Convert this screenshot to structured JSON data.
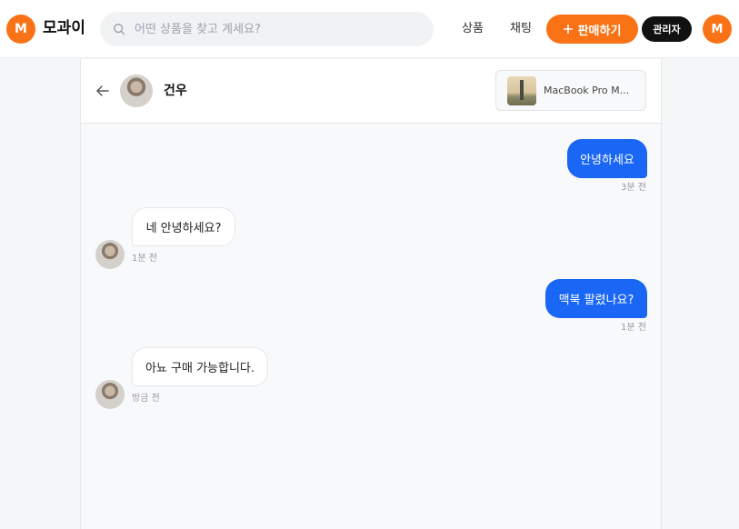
{
  "header": {
    "logo_letter": "M",
    "brand": "모과이",
    "search_placeholder": "어떤 상품을 찾고 계세요?",
    "nav": {
      "products": "상품",
      "chat": "채팅"
    },
    "sell_label": "판매하기",
    "admin_label": "관리자",
    "user_initial": "M",
    "accent_color": "#f97316"
  },
  "chat": {
    "partner_name": "건우",
    "product_title": "MacBook Pro M...",
    "messages": [
      {
        "sender": "me",
        "text": "안녕하세요",
        "time": "3분 전"
      },
      {
        "sender": "partner",
        "text": "네 안녕하세요?",
        "time": "1분 전"
      },
      {
        "sender": "me",
        "text": "맥북 팔렸나요?",
        "time": "1분 전"
      },
      {
        "sender": "partner",
        "text": "아뇨 구매 가능합니다.",
        "time": "방금 전"
      }
    ],
    "my_bubble_color": "#1a66f5"
  }
}
